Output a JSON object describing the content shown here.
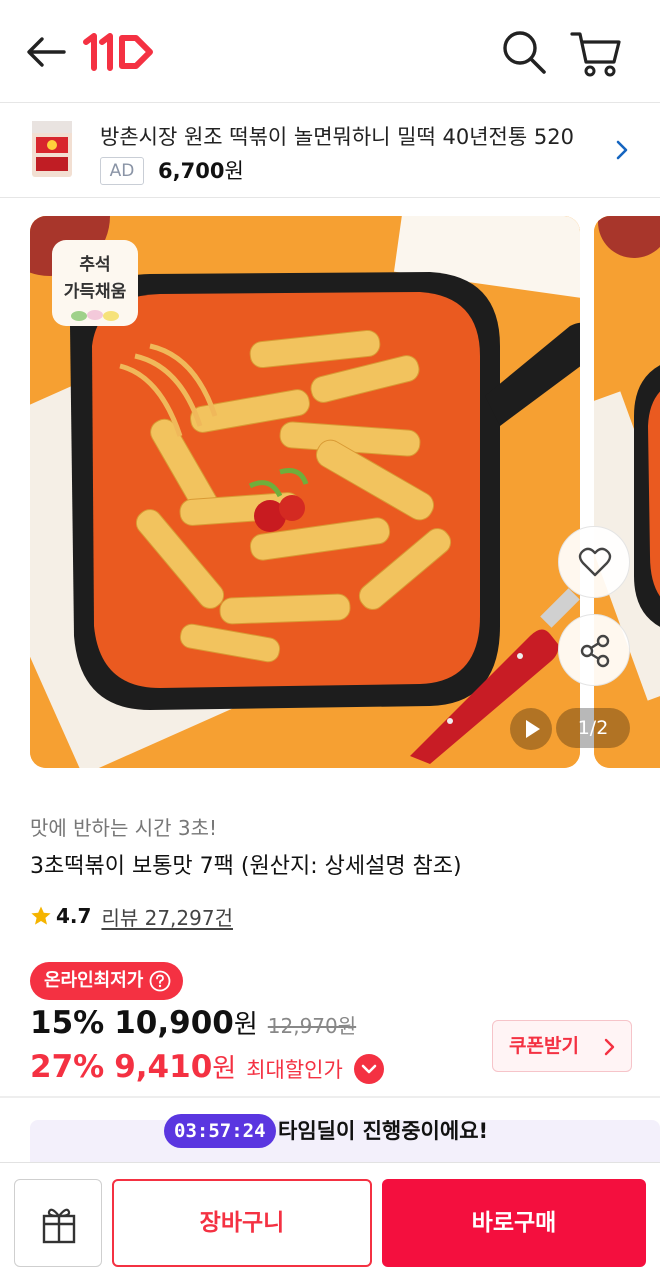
{
  "header": {
    "logo_text": "11",
    "back_icon": "arrow-left-icon",
    "search_icon": "search-icon",
    "cart_icon": "cart-icon"
  },
  "ad": {
    "title": "방촌시장 원조 떡볶이 놀면뭐하니 밀떡 40년전통 520",
    "badge": "AD",
    "price": "6,700",
    "price_unit": "원"
  },
  "gallery": {
    "sticker_line1": "추석",
    "sticker_line2": "가득채움",
    "page_indicator": "1/2",
    "like_icon": "heart-icon",
    "share_icon": "share-icon",
    "video_icon": "play-icon"
  },
  "product": {
    "subtitle": "맛에 반하는 시간 3초!",
    "title": "3초떡볶이 보통맛 7팩 (원산지: 상세설명 참조)",
    "rating": "4.7",
    "review_label": "리뷰 27,297건"
  },
  "pricing": {
    "lowest_badge": "온라인최저가",
    "discount": "15%",
    "price": "10,900",
    "unit": "원",
    "original_price": "12,970원",
    "max_discount": "27%",
    "max_price": "9,410",
    "max_unit": "원",
    "max_label": "최대할인가",
    "coupon_label": "쿠폰받기"
  },
  "timedeal": {
    "timer": "03:57:24",
    "text": "타임딜이 진행중이에요!"
  },
  "bottom_bar": {
    "cart_label": "장바구니",
    "buy_label": "바로구매",
    "gift_icon": "gift-icon"
  },
  "colors": {
    "brand_red": "#f43142",
    "buy_red": "#f40f3e",
    "timer_purple": "#5a36e0",
    "food_orange": "#f6a032"
  }
}
